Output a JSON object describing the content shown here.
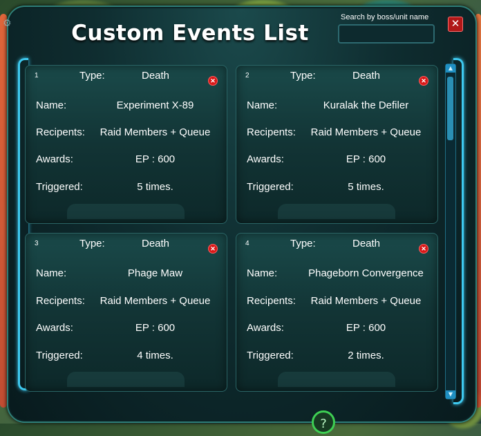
{
  "window": {
    "title": "Custom Events List",
    "search_label": "Search by boss/unit name",
    "search_value": "",
    "close_glyph": "✕"
  },
  "labels": {
    "type": "Type:",
    "name": "Name:",
    "recipients": "Recipents:",
    "awards": "Awards:",
    "triggered": "Triggered:"
  },
  "events": [
    {
      "index": "1",
      "type": "Death",
      "name": "Experiment X-89",
      "recipients": "Raid Members + Queue",
      "awards": "EP : 600",
      "triggered": "5 times."
    },
    {
      "index": "2",
      "type": "Death",
      "name": "Kuralak the Defiler",
      "recipients": "Raid Members + Queue",
      "awards": "EP : 600",
      "triggered": "5 times."
    },
    {
      "index": "3",
      "type": "Death",
      "name": "Phage Maw",
      "recipients": "Raid Members + Queue",
      "awards": "EP : 600",
      "triggered": "4 times."
    },
    {
      "index": "4",
      "type": "Death",
      "name": "Phageborn Convergence",
      "recipients": "Raid Members + Queue",
      "awards": "EP : 600",
      "triggered": "2 times."
    }
  ],
  "scrollbar": {
    "up_glyph": "▲",
    "down_glyph": "▼"
  },
  "help": {
    "glyph": "?"
  },
  "colors": {
    "accent": "#3ec9ef",
    "delete": "#d81818",
    "frame": "#2e7f78"
  }
}
